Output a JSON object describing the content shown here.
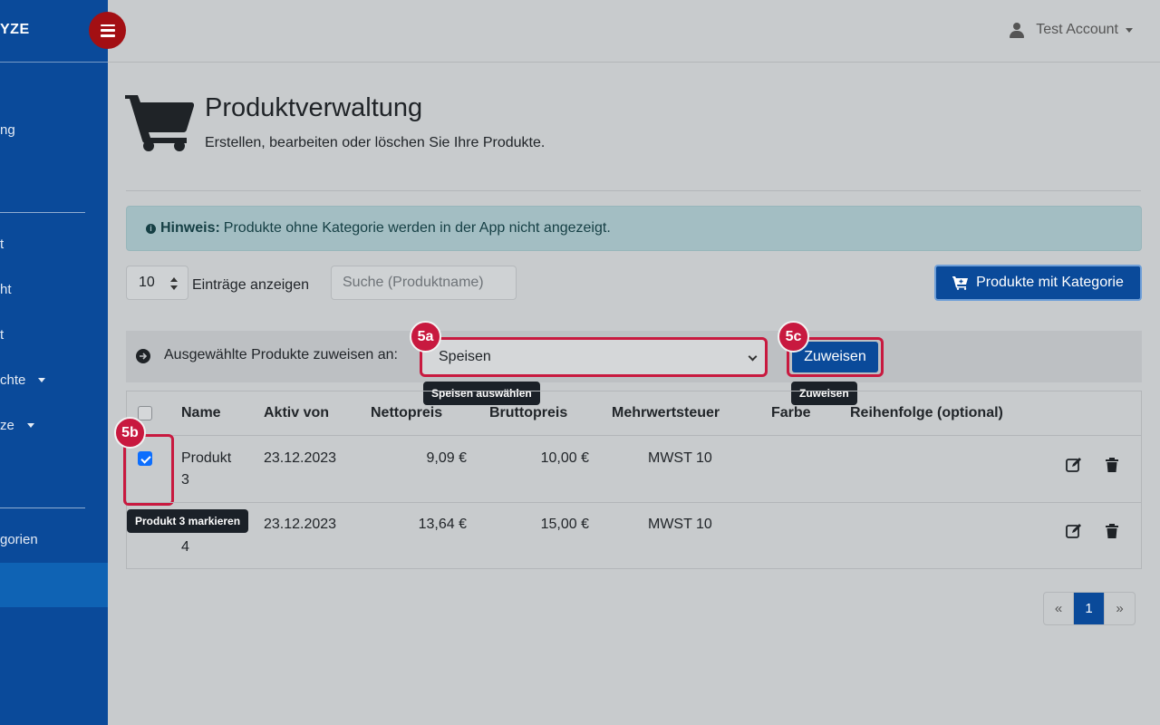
{
  "sidebar": {
    "brand": "YZE",
    "items": [
      {
        "label": "ng",
        "top": 0
      },
      {
        "label": "t"
      },
      {
        "label": "ht"
      },
      {
        "label": "t"
      },
      {
        "label": "chte"
      },
      {
        "label": "ze"
      },
      {
        "label": "gorien"
      }
    ]
  },
  "header": {
    "account_name": "Test Account"
  },
  "page": {
    "title": "Produktverwaltung",
    "subtitle": "Erstellen, bearbeiten oder löschen Sie Ihre Produkte."
  },
  "alert": {
    "strong": "Hinweis:",
    "text": "Produkte ohne Kategorie werden in der App nicht angezeigt."
  },
  "controls": {
    "page_length": "10",
    "page_length_label": "Einträge anzeigen",
    "search_placeholder": "Suche (Produktname)",
    "category_button": "Produkte mit Kategorie"
  },
  "assign": {
    "label": "Ausgewählte Produkte zuweisen an:",
    "selected": "Speisen",
    "button": "Zuweisen"
  },
  "annotations": {
    "badge_select": "5a",
    "badge_checkbox": "5b",
    "badge_button": "5c",
    "tip_select": "Speisen auswählen",
    "tip_checkbox": "Produkt 3 markieren",
    "tip_button": "Zuweisen"
  },
  "table": {
    "columns": [
      "Name",
      "Aktiv von",
      "Nettopreis",
      "Bruttopreis",
      "Mehrwertsteuer",
      "Farbe",
      "Reihenfolge (optional)"
    ],
    "rows": [
      {
        "name_1": "Produkt",
        "name_2": "3",
        "active_from": "23.12.2023",
        "net": "9,09 €",
        "gross": "10,00 €",
        "vat": "MWST 10",
        "checked": true
      },
      {
        "name_1": "Produkt",
        "name_2": "4",
        "active_from": "23.12.2023",
        "net": "13,64 €",
        "gross": "15,00 €",
        "vat": "MWST 10",
        "checked": false
      }
    ]
  },
  "pagination": {
    "prev": "«",
    "current": "1",
    "next": "»"
  },
  "colors": {
    "sidebar": "#0a4a9a",
    "accent_red": "#c8193f",
    "primary": "#0a4a9a"
  }
}
